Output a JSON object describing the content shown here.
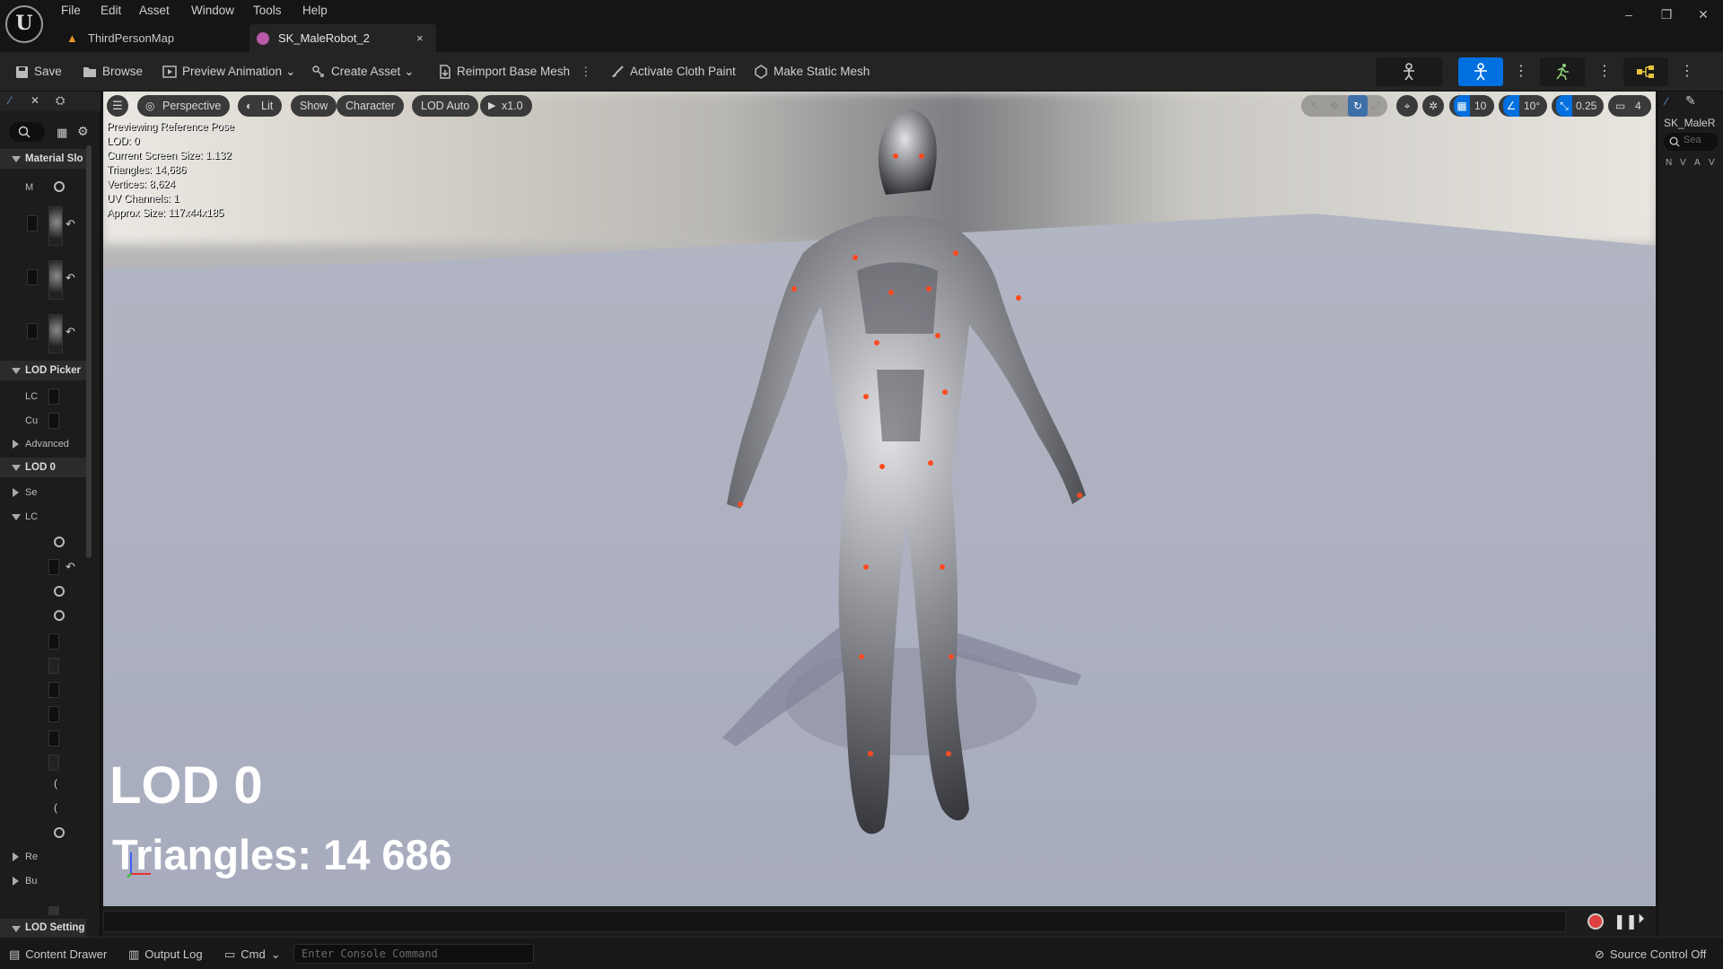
{
  "menu": [
    "File",
    "Edit",
    "Asset",
    "Window",
    "Tools",
    "Help"
  ],
  "tabs": {
    "map_tab": "ThirdPersonMap",
    "asset_tab": "SK_MaleRobot_2",
    "close": "×"
  },
  "window": {
    "minimize": "–",
    "restore": "❐",
    "close": "✕"
  },
  "toolbar": {
    "save": "Save",
    "browse": "Browse",
    "preview_animation": "Preview Animation",
    "create_asset": "Create Asset",
    "reimport": "Reimport Base Mesh",
    "cloth_paint": "Activate Cloth Paint",
    "static_mesh": "Make Static Mesh"
  },
  "left_panel": {
    "material_slots": "Material Slo",
    "m_label": "M",
    "lod_picker": "LOD Picker",
    "lod_row1": "LC",
    "lod_row2": "Cu",
    "advanced": "Advanced",
    "lod0": "LOD 0",
    "se": "Se",
    "lc": "LC",
    "re": "Re",
    "bu": "Bu",
    "lod_settings": "LOD Setting"
  },
  "viewport": {
    "perspective": "Perspective",
    "lit": "Lit",
    "show": "Show",
    "character": "Character",
    "lod_auto": "LOD Auto",
    "speed": "x1.0",
    "grid_snap": "10",
    "rot_snap": "10°",
    "scale_snap": "0.25",
    "cam_speed": "4",
    "stats": [
      "Previewing Reference Pose",
      "LOD: 0",
      "Current Screen Size: 1.132",
      "Triangles: 14,686",
      "Vertices: 8,624",
      "UV Channels: 1",
      "Approx Size: 117x44x185"
    ],
    "lod_overlay": "LOD 0",
    "tri_overlay": "Triangles: 14 686"
  },
  "right_panel": {
    "title": "SK_MaleR",
    "search": "Sea",
    "cols": [
      "N",
      "V",
      "A",
      "V"
    ]
  },
  "statusbar": {
    "content_drawer": "Content Drawer",
    "output_log": "Output Log",
    "cmd": "Cmd",
    "console_placeholder": "Enter Console Command",
    "source_control": "Source Control Off"
  },
  "colors": {
    "accent": "#0070e0",
    "bg": "#151515",
    "panel": "#242424"
  }
}
